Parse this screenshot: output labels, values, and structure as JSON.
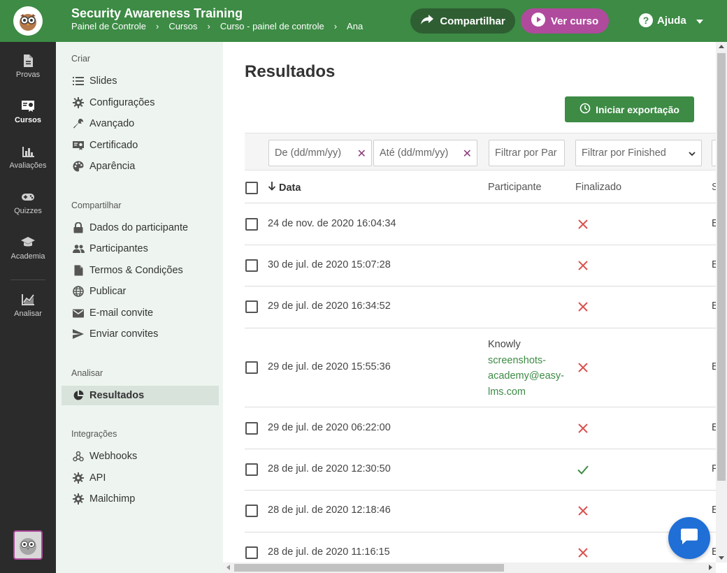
{
  "app": {
    "title": "Security Awareness Training",
    "breadcrumbs": [
      "Painel de Controle",
      "Cursos",
      "Curso - painel de controle",
      "Ana"
    ]
  },
  "topbar": {
    "share_label": "Compartilhar",
    "view_course_label": "Ver curso",
    "help_label": "Ajuda"
  },
  "rail": {
    "items": [
      {
        "label": "Provas",
        "icon": "document-icon"
      },
      {
        "label": "Cursos",
        "icon": "certificate-icon"
      },
      {
        "label": "Avaliações",
        "icon": "bar-chart-icon"
      },
      {
        "label": "Quizzes",
        "icon": "gamepad-icon"
      },
      {
        "label": "Academia",
        "icon": "graduation-cap-icon"
      },
      {
        "label": "Analisar",
        "icon": "line-chart-icon"
      }
    ]
  },
  "subnav": {
    "sections": [
      {
        "heading": "Criar",
        "items": [
          "Slides",
          "Configurações",
          "Avançado",
          "Certificado",
          "Aparência"
        ]
      },
      {
        "heading": "Compartilhar",
        "items": [
          "Dados do participante",
          "Participantes",
          "Termos & Condições",
          "Publicar",
          "E-mail convite",
          "Enviar convites"
        ]
      },
      {
        "heading": "Analisar",
        "items": [
          "Resultados"
        ]
      },
      {
        "heading": "Integrações",
        "items": [
          "Webhooks",
          "API",
          "Mailchimp"
        ]
      }
    ]
  },
  "main": {
    "title": "Resultados",
    "export_label": "Iniciar exportação",
    "filters": {
      "from_placeholder": "De (dd/mm/yy)",
      "to_placeholder": "Até (dd/mm/yy)",
      "participant_placeholder": "Filtrar por Par",
      "finished_select": "Filtrar por Finished"
    },
    "columns": {
      "date": "Data",
      "participant": "Participante",
      "finished": "Finalizado",
      "truncated": "S"
    },
    "rows": [
      {
        "date": "24 de nov. de 2020 16:04:34",
        "participant_name": "",
        "participant_email": "",
        "finished": false,
        "trunc": "E"
      },
      {
        "date": "30 de jul. de 2020 15:07:28",
        "participant_name": "",
        "participant_email": "",
        "finished": false,
        "trunc": "E"
      },
      {
        "date": "29 de jul. de 2020 16:34:52",
        "participant_name": "",
        "participant_email": "",
        "finished": false,
        "trunc": "E"
      },
      {
        "date": "29 de jul. de 2020 15:55:36",
        "participant_name": "Knowly",
        "participant_email": "screenshots-academy@easy-lms.com",
        "finished": false,
        "trunc": "E"
      },
      {
        "date": "29 de jul. de 2020 06:22:00",
        "participant_name": "",
        "participant_email": "",
        "finished": false,
        "trunc": "E"
      },
      {
        "date": "28 de jul. de 2020 12:30:50",
        "participant_name": "",
        "participant_email": "",
        "finished": true,
        "trunc": "F"
      },
      {
        "date": "28 de jul. de 2020 12:18:46",
        "participant_name": "",
        "participant_email": "",
        "finished": false,
        "trunc": "E"
      },
      {
        "date": "28 de jul. de 2020 11:16:15",
        "participant_name": "",
        "participant_email": "",
        "finished": false,
        "trunc": "E"
      }
    ]
  },
  "colors": {
    "brand_green": "#3d8b45",
    "accent_purple": "#b04a9d",
    "cross_red": "#d9534f",
    "check_green": "#3d8b45",
    "chat_blue": "#1f6fd6"
  }
}
